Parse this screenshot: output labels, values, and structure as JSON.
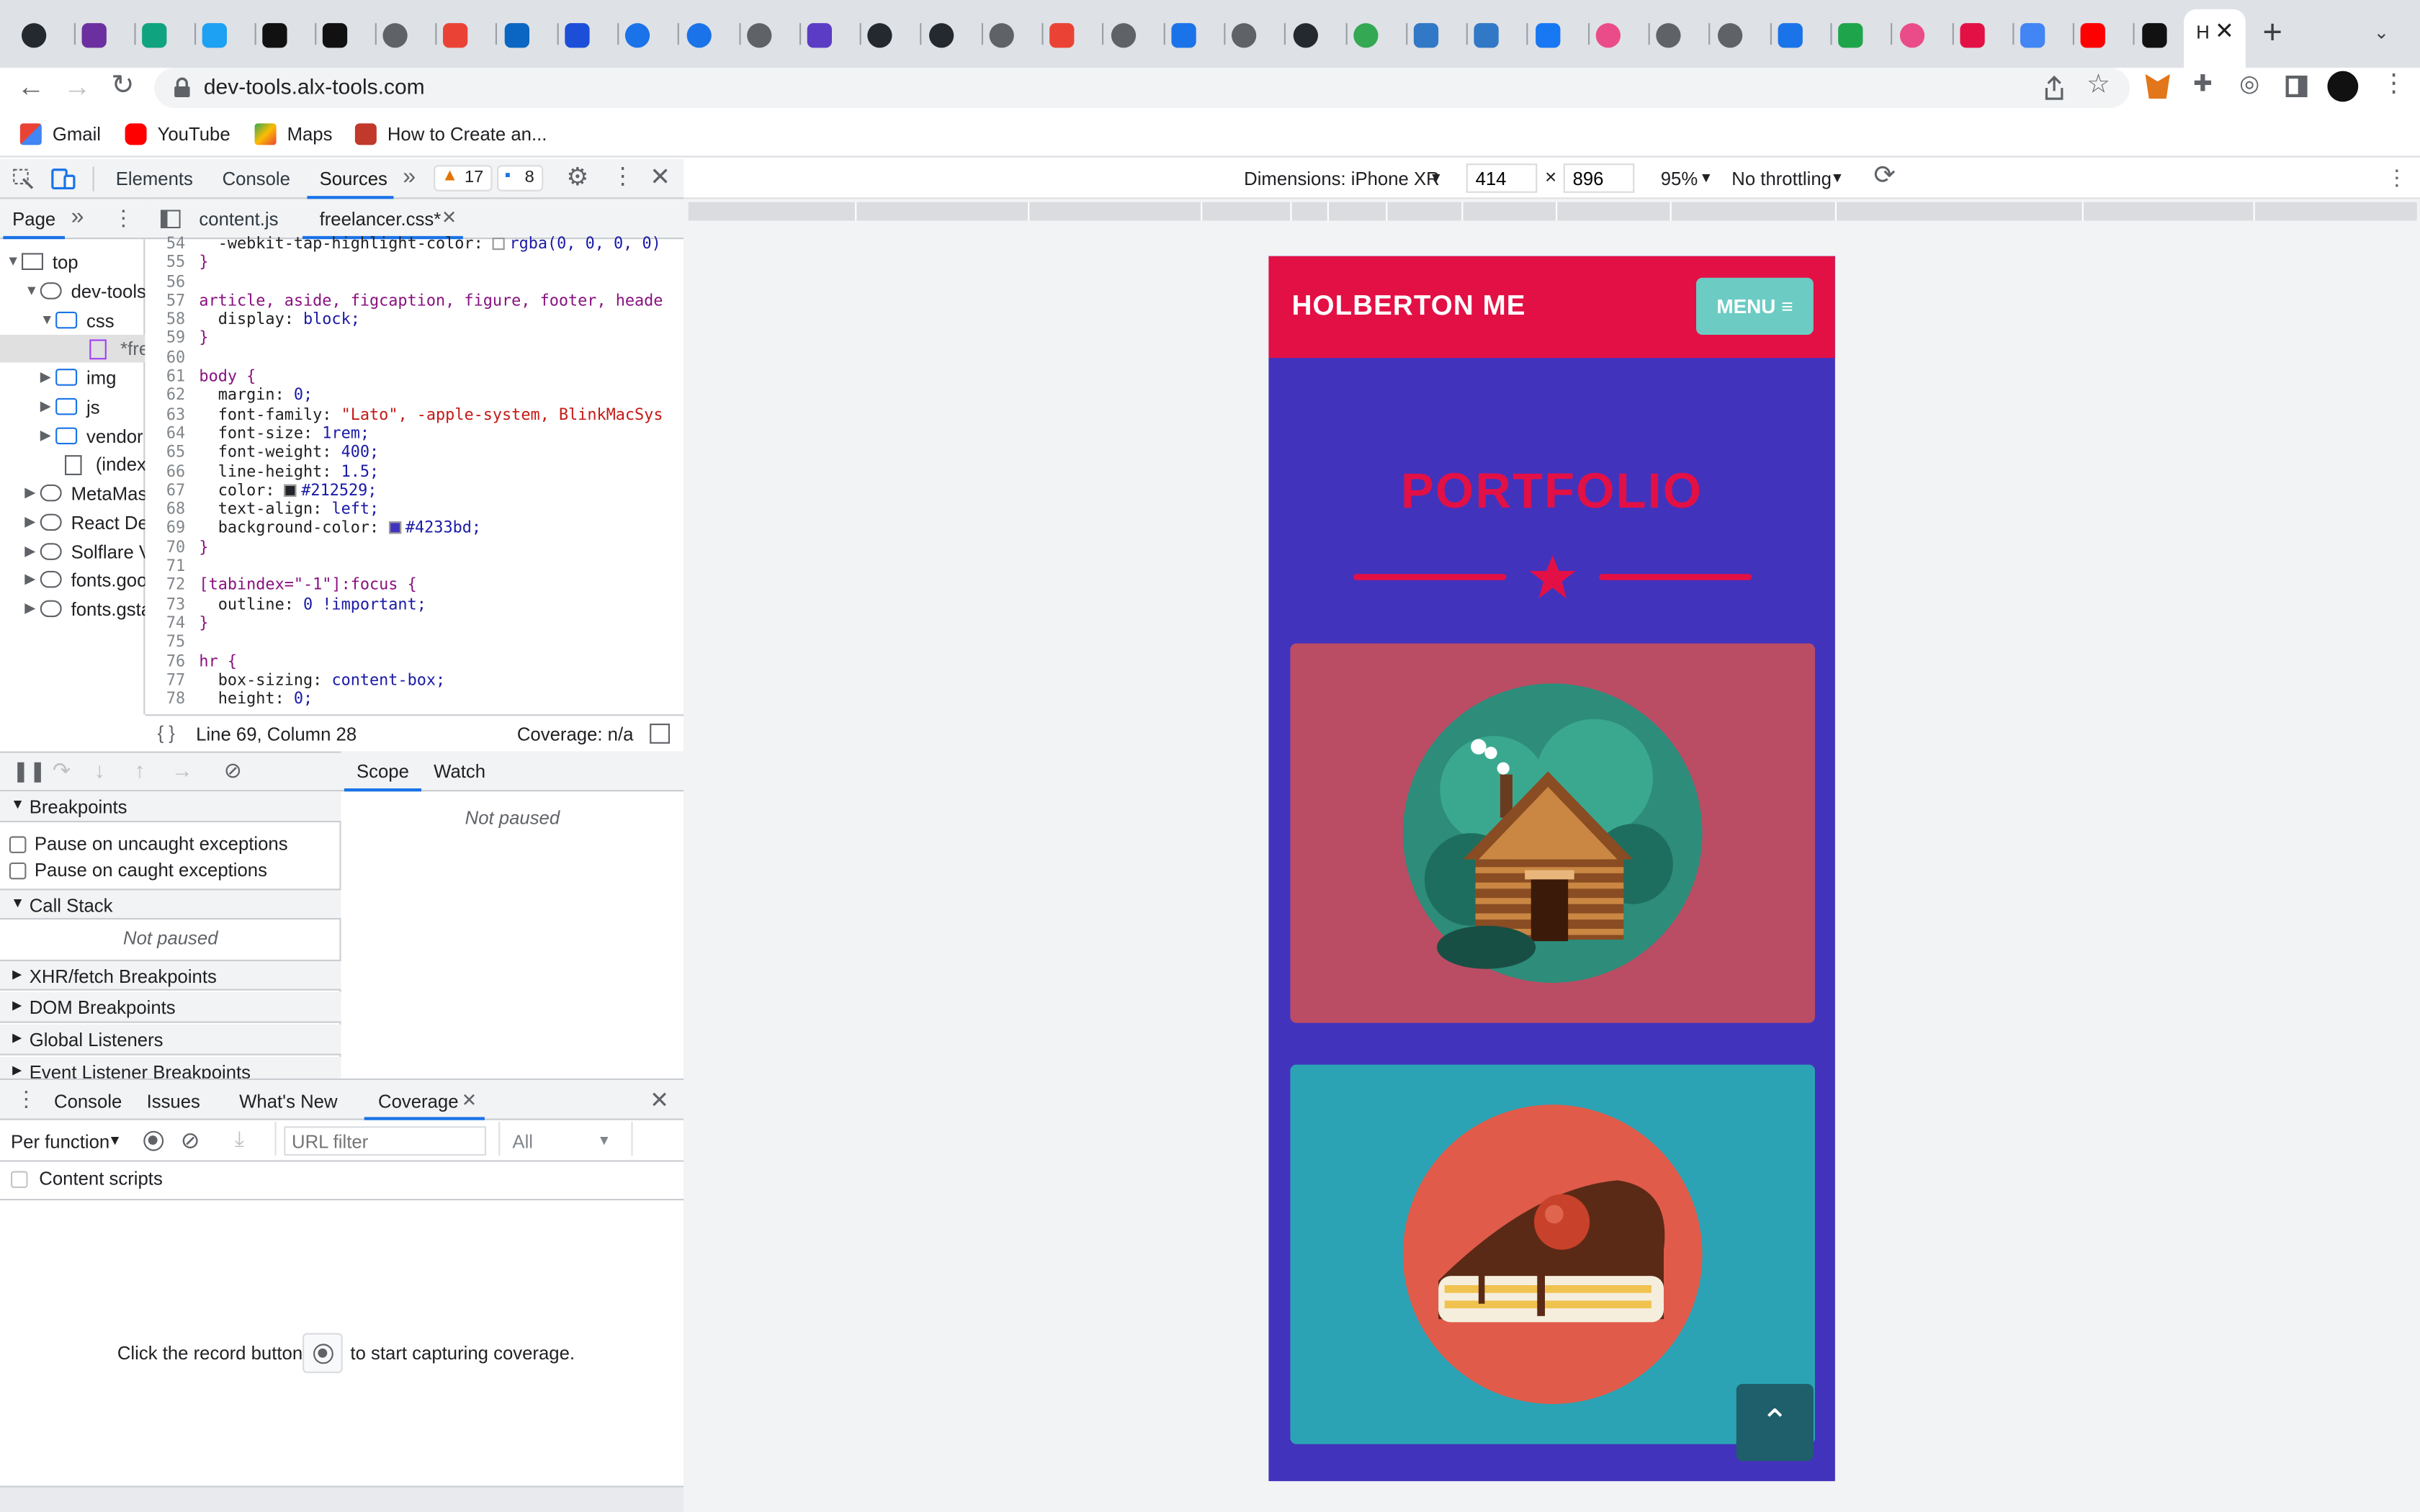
{
  "browser": {
    "url": "dev-tools.alx-tools.com",
    "bookmarks": [
      "Gmail",
      "YouTube",
      "Maps",
      "How to Create an..."
    ]
  },
  "devtools": {
    "tabs": [
      "Elements",
      "Console",
      "Sources"
    ],
    "warnings": "17",
    "messages": "8",
    "nav_tabs": [
      "Page"
    ],
    "file_tabs": [
      "content.js",
      "freelancer.css*"
    ],
    "tree": [
      "top",
      "dev-tools",
      "css",
      "*free",
      "img",
      "js",
      "vendor",
      "(index)",
      "MetaMas",
      "React De",
      "Solflare V",
      "fonts.goo",
      "fonts.gsta"
    ],
    "code_lines": [
      {
        "n": "54",
        "t": "  -webkit-tap-highlight-color: ",
        "v": "rgba(0, 0, 0, 0)"
      },
      {
        "n": "55",
        "t": "}",
        "v": ""
      },
      {
        "n": "56",
        "t": "",
        "v": ""
      },
      {
        "n": "57",
        "t": "article, aside, figcaption, figure, footer, heade",
        "v": ""
      },
      {
        "n": "58",
        "t": "  display: ",
        "v": "block;"
      },
      {
        "n": "59",
        "t": "}",
        "v": ""
      },
      {
        "n": "60",
        "t": "",
        "v": ""
      },
      {
        "n": "61",
        "t": "body {",
        "v": ""
      },
      {
        "n": "62",
        "t": "  margin: ",
        "v": "0;"
      },
      {
        "n": "63",
        "t": "  font-family: ",
        "v": "\"Lato\", -apple-system, BlinkMacSys"
      },
      {
        "n": "64",
        "t": "  font-size: ",
        "v": "1rem;"
      },
      {
        "n": "65",
        "t": "  font-weight: ",
        "v": "400;"
      },
      {
        "n": "66",
        "t": "  line-height: ",
        "v": "1.5;"
      },
      {
        "n": "67",
        "t": "  color: ",
        "v": "#212529;"
      },
      {
        "n": "68",
        "t": "  text-align: ",
        "v": "left;"
      },
      {
        "n": "69",
        "t": "  background-color: ",
        "v": "#4233bd;"
      },
      {
        "n": "70",
        "t": "}",
        "v": ""
      },
      {
        "n": "71",
        "t": "",
        "v": ""
      },
      {
        "n": "72",
        "t": "[tabindex=\"-1\"]:focus {",
        "v": ""
      },
      {
        "n": "73",
        "t": "  outline: ",
        "v": "0 !important;"
      },
      {
        "n": "74",
        "t": "}",
        "v": ""
      },
      {
        "n": "75",
        "t": "",
        "v": ""
      },
      {
        "n": "76",
        "t": "hr {",
        "v": ""
      },
      {
        "n": "77",
        "t": "  box-sizing: ",
        "v": "content-box;"
      },
      {
        "n": "78",
        "t": "  height: ",
        "v": "0;"
      }
    ],
    "status": {
      "position": "Line 69, Column 28",
      "coverage": "Coverage: n/a"
    },
    "debugger": {
      "scope_tab": "Scope",
      "watch_tab": "Watch",
      "not_paused": "Not paused",
      "breakpoints": "Breakpoints",
      "pause_uncaught": "Pause on uncaught exceptions",
      "pause_caught": "Pause on caught exceptions",
      "call_stack": "Call Stack",
      "call_stack_state": "Not paused",
      "sections": [
        "XHR/fetch Breakpoints",
        "DOM Breakpoints",
        "Global Listeners",
        "Event Listener Breakpoints"
      ]
    },
    "drawer": {
      "tabs": [
        "Console",
        "Issues",
        "What's New",
        "Coverage"
      ],
      "per_function": "Per function",
      "url_filter_placeholder": "URL filter",
      "type_filter": "All",
      "content_scripts": "Content scripts",
      "hint_before": "Click the record button",
      "hint_after": "to start capturing coverage."
    }
  },
  "device_toolbar": {
    "dimensions": "Dimensions: iPhone XR",
    "width": "414",
    "height": "896",
    "zoom": "95%",
    "throttling": "No throttling"
  },
  "page": {
    "brand": "HOLBERTON ME",
    "menu_label": "MENU",
    "portfolio_title": "PORTFOLIO",
    "colors": {
      "header": "#e31045",
      "background": "#4233bd",
      "card1": "#ba4d64",
      "card2": "#2ba3b5",
      "menu": "#6ccbc3"
    }
  }
}
